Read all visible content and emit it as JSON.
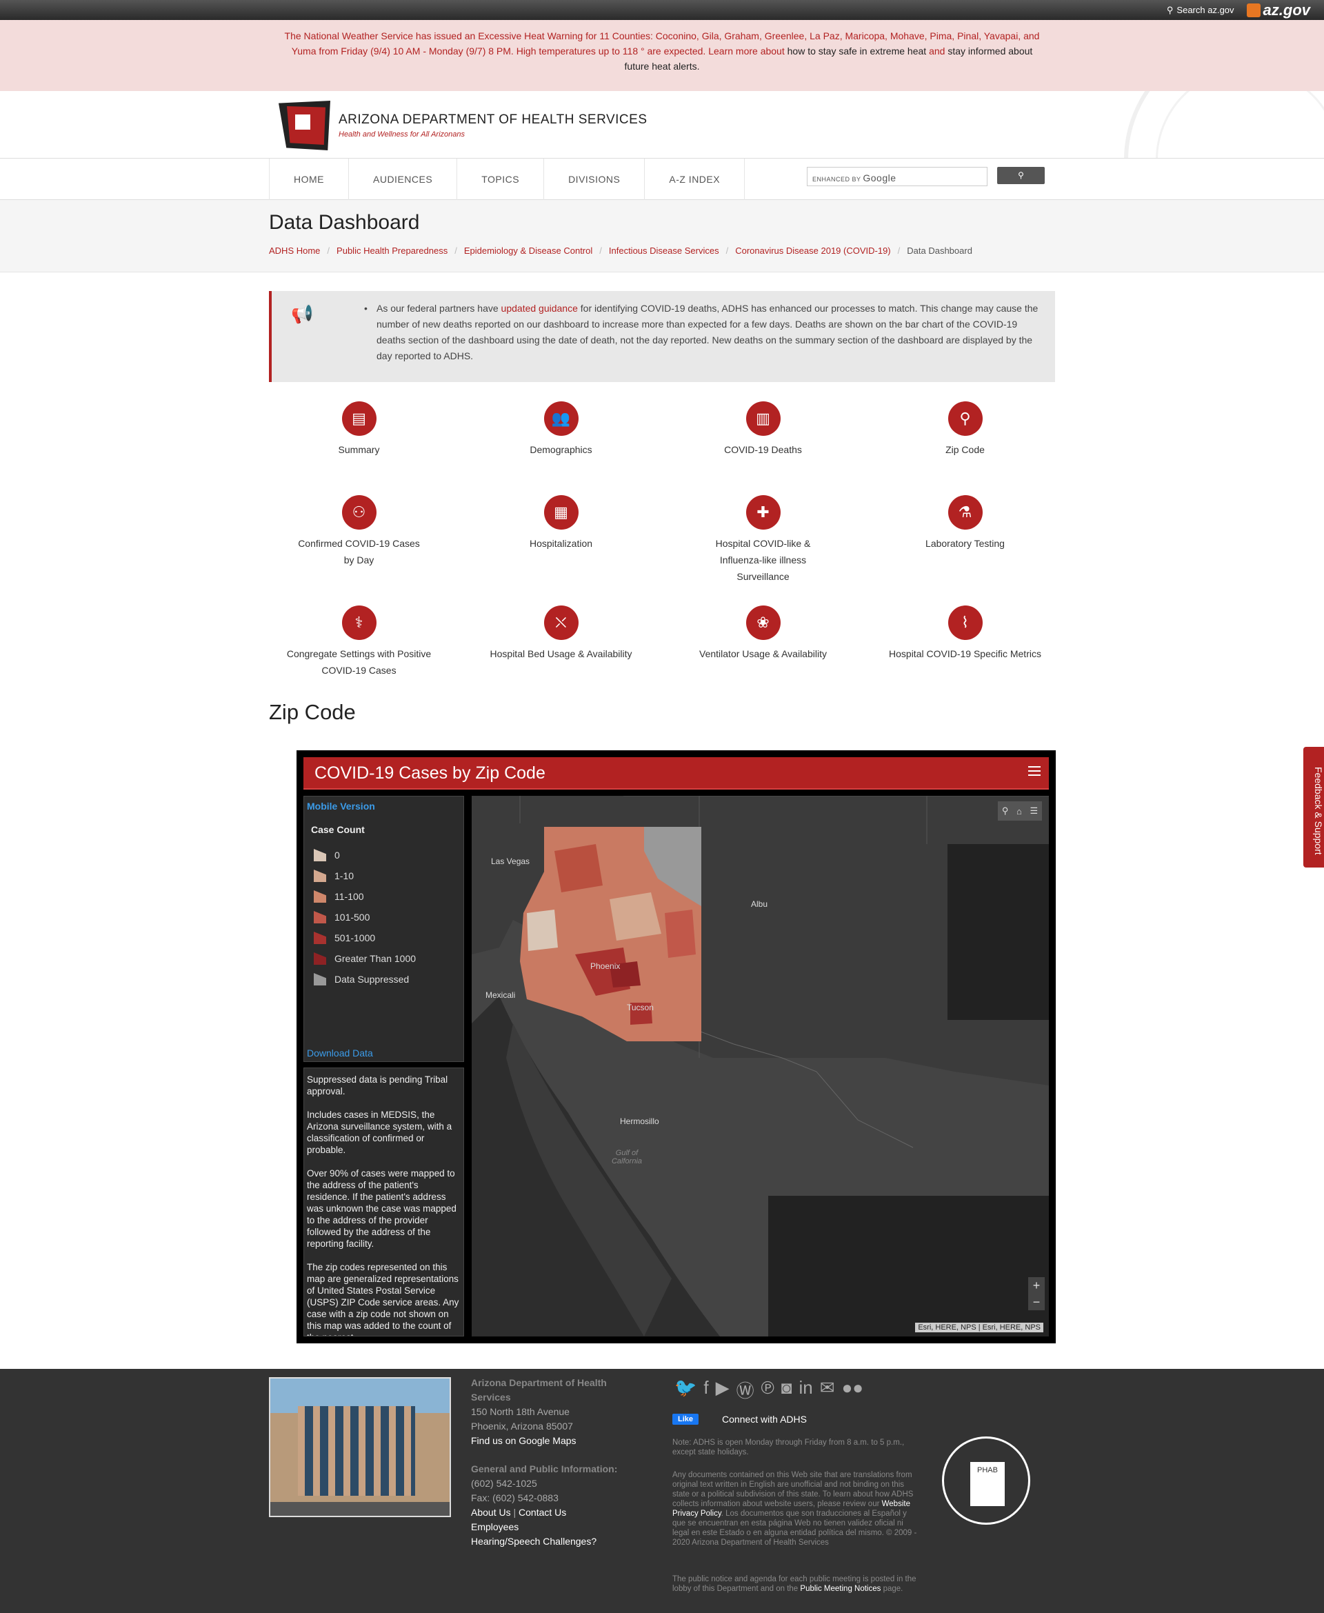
{
  "topbar": {
    "search_label": "Search az.gov",
    "azgov_label": "az.gov"
  },
  "alert": {
    "text1": "The National Weather Service has issued an Excessive Heat Warning for 11 Counties: Coconino, Gila, Graham, Greenlee, La Paz, Maricopa, Mohave, Pima, Pinal, Yavapai, and",
    "text2": "Yuma from Friday (9/4) 10 AM - Monday (9/7) 8 PM. High temperatures up to 118 ° are expected. Learn more about",
    "link1": "how to stay safe in extreme heat",
    "and": "and",
    "link2": "stay informed about",
    "text3": "future heat alerts."
  },
  "header": {
    "org_name": "ARIZONA DEPARTMENT OF HEALTH SERVICES",
    "tagline": "Health and Wellness for All Arizonans"
  },
  "nav": {
    "items": [
      "HOME",
      "AUDIENCES",
      "TOPICS",
      "DIVISIONS",
      "A-Z INDEX"
    ],
    "search_enhanced": "ENHANCED BY",
    "search_google": "Google"
  },
  "page": {
    "title": "Data Dashboard",
    "breadcrumbs": [
      "ADHS Home",
      "Public Health Preparedness",
      "Epidemiology & Disease Control",
      "Infectious Disease Services",
      "Coronavirus Disease 2019 (COVID-19)"
    ],
    "breadcrumb_current": "Data Dashboard"
  },
  "notice": {
    "pre": "As our federal partners have",
    "link": "updated guidance",
    "post": "for identifying COVID-19 deaths, ADHS has enhanced our processes to match. This change may cause the number of new deaths reported on our dashboard to increase more than expected for a few days. Deaths are shown on the bar chart of the COVID-19 deaths section of the dashboard using the date of death, not the day reported. New deaths on the summary section of the dashboard are displayed by the day reported to ADHS."
  },
  "tiles": [
    {
      "label": "Summary",
      "icon": "▤"
    },
    {
      "label": "Demographics",
      "icon": "👥"
    },
    {
      "label": "COVID-19 Deaths",
      "icon": "▥"
    },
    {
      "label": "Zip Code",
      "icon": "⚲"
    },
    {
      "label": "Confirmed COVID-19 Cases by Day",
      "icon": "⚇"
    },
    {
      "label": "Hospitalization",
      "icon": "▦"
    },
    {
      "label": "Hospital COVID-like & Influenza-like illness Surveillance",
      "icon": "✚"
    },
    {
      "label": "Laboratory Testing",
      "icon": "⚗"
    },
    {
      "label": "Congregate Settings with Positive COVID-19 Cases",
      "icon": "⚕"
    },
    {
      "label": "Hospital Bed Usage & Availability",
      "icon": "⛌"
    },
    {
      "label": "Ventilator Usage & Availability",
      "icon": "❀"
    },
    {
      "label": "Hospital COVID-19 Specific Metrics",
      "icon": "⌇"
    }
  ],
  "section": {
    "zip_heading": "Zip Code"
  },
  "map": {
    "title": "COVID-19 Cases by Zip Code",
    "mobile_version": "Mobile Version",
    "legend_title": "Case Count",
    "legend": [
      {
        "label": "0",
        "color": "#d9c6b6"
      },
      {
        "label": "1-10",
        "color": "#d4a88f"
      },
      {
        "label": "11-100",
        "color": "#cf876b"
      },
      {
        "label": "101-500",
        "color": "#c1584a"
      },
      {
        "label": "501-1000",
        "color": "#a8322f"
      },
      {
        "label": "Greater Than 1000",
        "color": "#8e2224"
      },
      {
        "label": "Data Suppressed",
        "color": "#999999"
      }
    ],
    "download": "Download Data",
    "info": [
      "Suppressed data is pending Tribal approval.",
      "Includes cases in MEDSIS, the Arizona surveillance system, with a classification of confirmed or probable.",
      "Over 90% of cases were mapped to the address of the patient's residence.  If the patient's address was unknown the case was mapped to the address of the provider followed by the address of the reporting facility.",
      "The zip codes represented on this map are generalized representations of United States Postal Service (USPS) ZIP Code service areas. Any case with a zip code not shown on this map was added to the count of the nearest"
    ],
    "places": [
      "Las Vegas",
      "Albu",
      "Mexicali",
      "Phoenix",
      "Tucson",
      "Hermosillo",
      "Gulf of Calfornia"
    ],
    "zoom_in": "+",
    "zoom_out": "−",
    "attribution": "Esri, HERE, NPS | Esri, HERE, NPS"
  },
  "feedback": "Feedback & Support",
  "footer": {
    "org": "Arizona Department of Health Services",
    "addr1": "150 North 18th Avenue",
    "addr2": "Phoenix, Arizona 85007",
    "maps_link": "Find us on Google Maps",
    "gen_info": "General and Public Information:",
    "phone": "(602) 542-1025",
    "fax": "Fax: (602) 542-0883",
    "about": "About Us",
    "contact": "Contact Us",
    "employees": "Employees",
    "hearing": "Hearing/Speech Challenges?",
    "like": "Like",
    "connect": "Connect with ADHS",
    "note": "Note: ADHS is open Monday through Friday from 8 a.m. to 5 p.m., except state holidays.",
    "disclaimer_pre": "Any documents contained on this Web site that are translations from original text written in English are unofficial and not binding on this state or a political subdivision of this state. To learn about how ADHS collects information about website users, please review our",
    "privacy": "Website Privacy Policy",
    "disclaimer_post": ". Los documentos que son traducciones al Español y que se encuentran en esta página Web no tienen validez oficial ni legal en este Estado o en alguna entidad política del mismo. © 2009 - 2020 Arizona Department of Health Services",
    "public_pre": "The public notice and agenda for each public meeting is posted in the lobby of this Department and on the",
    "public_link": "Public Meeting Notices",
    "public_post": "page.",
    "social": [
      "twitter-icon",
      "facebook-icon",
      "youtube-icon",
      "wordpress-icon",
      "pinterest-icon",
      "instagram-icon",
      "linkedin-icon",
      "email-icon",
      "flickr-icon"
    ]
  }
}
